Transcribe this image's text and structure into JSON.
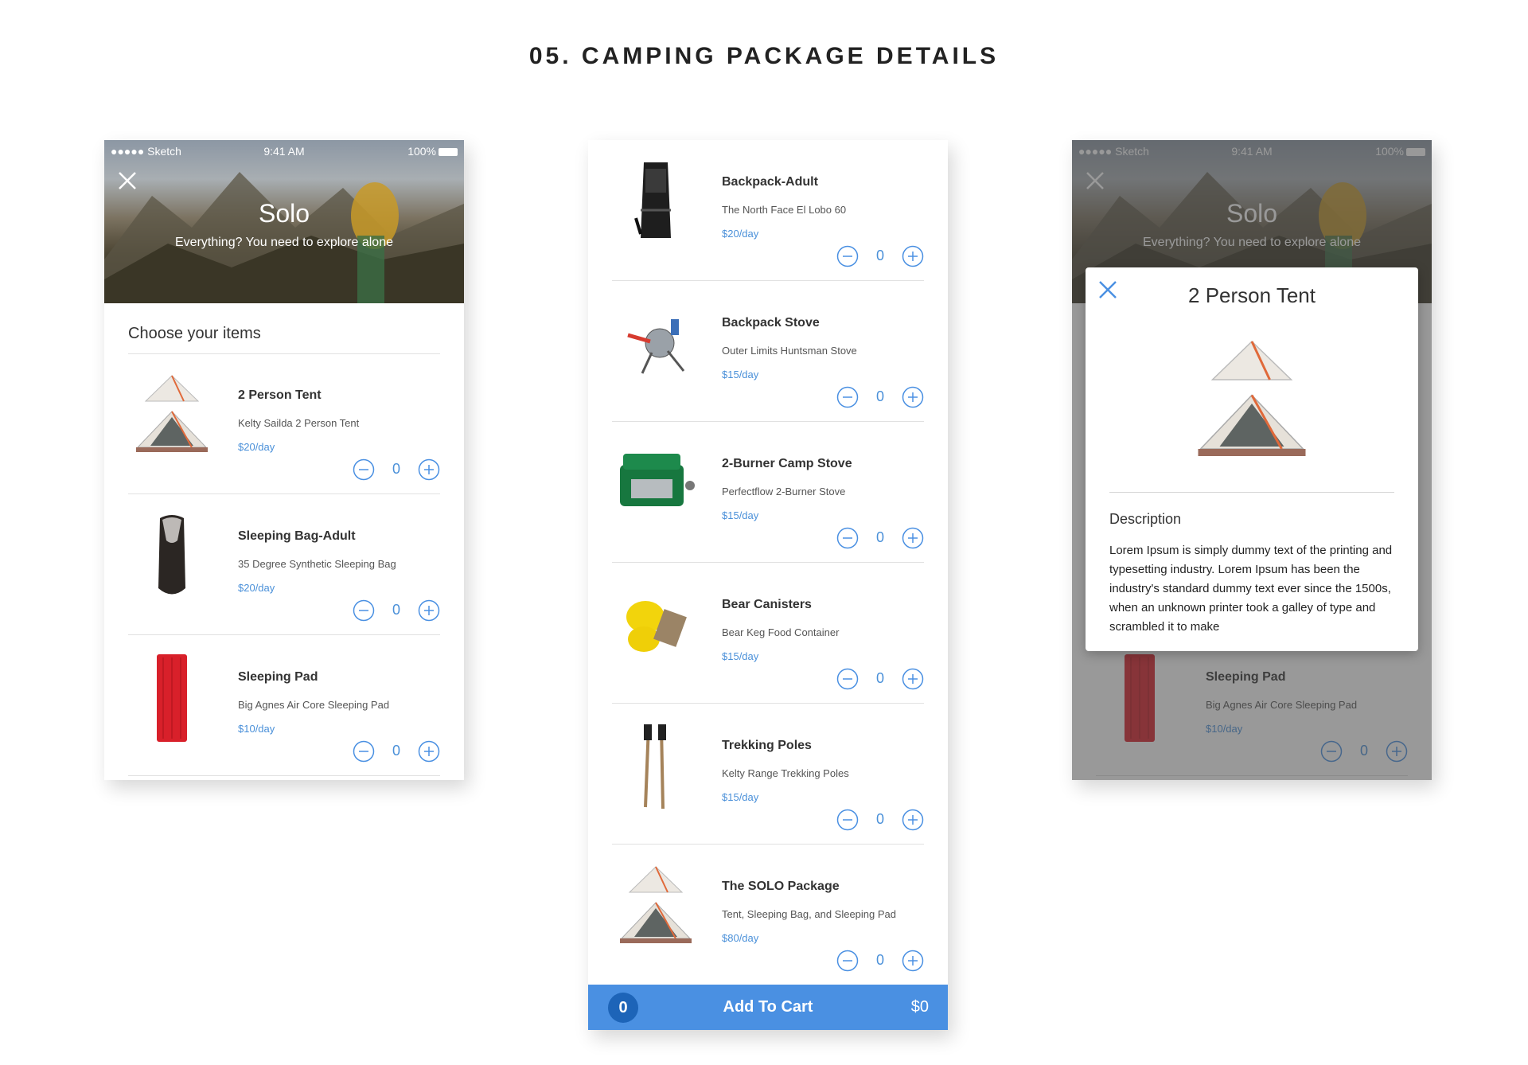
{
  "page": {
    "title": "05. CAMPING PACKAGE DETAILS"
  },
  "status_bar": {
    "carrier": "●●●●● Sketch",
    "time": "9:41 AM",
    "battery": "100%"
  },
  "hero": {
    "title": "Solo",
    "subtitle": "Everything? You need to explore alone"
  },
  "list": {
    "section_title": "Choose your items",
    "items": [
      {
        "name": "2 Person Tent",
        "description": "Kelty Sailda 2 Person Tent",
        "price": "$20/day",
        "quantity": "0",
        "icon": "tent-icon"
      },
      {
        "name": "Sleeping Bag-Adult",
        "description": "35 Degree Synthetic Sleeping Bag",
        "price": "$20/day",
        "quantity": "0",
        "icon": "sleeping-bag-icon"
      },
      {
        "name": "Sleeping Pad",
        "description": "Big Agnes Air Core Sleeping Pad",
        "price": "$10/day",
        "quantity": "0",
        "icon": "sleeping-pad-icon"
      },
      {
        "name": "Backpack-Adult",
        "description": "The North Face El Lobo 60",
        "price": "$20/day",
        "quantity": "0",
        "icon": "backpack-icon"
      },
      {
        "name": "Backpack Stove",
        "description": "Outer Limits Huntsman Stove",
        "price": "$15/day",
        "quantity": "0",
        "icon": "backpack-stove-icon"
      },
      {
        "name": "2-Burner Camp Stove",
        "description": "Perfectflow 2-Burner Stove",
        "price": "$15/day",
        "quantity": "0",
        "icon": "camp-stove-icon"
      },
      {
        "name": "Bear Canisters",
        "description": "Bear Keg Food Container",
        "price": "$15/day",
        "quantity": "0",
        "icon": "bear-canister-icon"
      },
      {
        "name": "Trekking Poles",
        "description": "Kelty Range Trekking Poles",
        "price": "$15/day",
        "quantity": "0",
        "icon": "trekking-poles-icon"
      },
      {
        "name": "The SOLO Package",
        "description": "Tent, Sleeping Bag, and Sleeping Pad",
        "price": "$80/day",
        "quantity": "0",
        "icon": "tent-icon"
      }
    ]
  },
  "cart": {
    "count": "0",
    "label": "Add To Cart",
    "total": "$0"
  },
  "modal": {
    "title": "2 Person Tent",
    "description_label": "Description",
    "description_text": "Lorem Ipsum is simply dummy text of the printing and typesetting industry. Lorem Ipsum has been the industry's standard dummy text ever since the 1500s, when an unknown printer took a galley of type and scrambled it to make"
  },
  "colors": {
    "accent": "#4a90e2",
    "price": "#4a90d9",
    "cart_badge": "#1d64b8",
    "tent_orange": "#e0693a"
  }
}
